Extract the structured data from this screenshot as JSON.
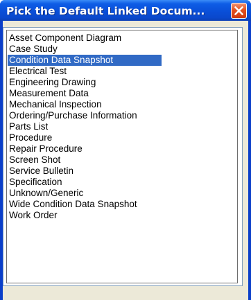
{
  "dialog": {
    "title": "Pick the Default Linked Docum...",
    "close_icon": "close-x-icon",
    "colors": {
      "titlebar": "#0a4fd8",
      "close_button": "#e3501e",
      "selection": "#316ac5"
    }
  },
  "list": {
    "selected_index": 2,
    "items": [
      "Asset Component Diagram",
      "Case Study",
      "Condition Data Snapshot",
      "Electrical Test",
      "Engineering Drawing",
      "Measurement Data",
      "Mechanical Inspection",
      "Ordering/Purchase Information",
      "Parts List",
      "Procedure",
      "Repair Procedure",
      "Screen Shot",
      "Service Bulletin",
      "Specification",
      "Unknown/Generic",
      "Wide Condition Data Snapshot",
      "Work Order"
    ]
  }
}
